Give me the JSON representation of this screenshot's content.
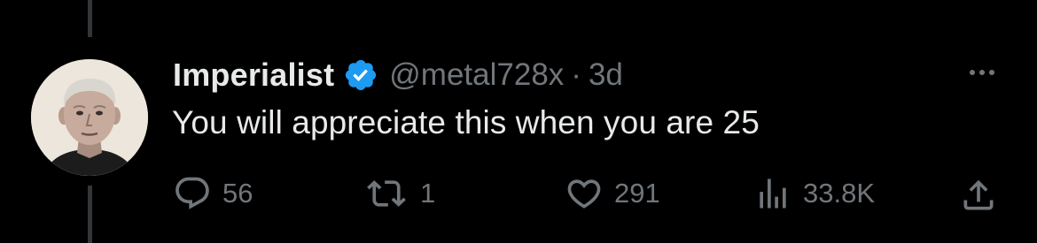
{
  "tweet": {
    "display_name": "Imperialist",
    "handle": "@metal728x",
    "separator": "·",
    "time": "3d",
    "text": "You will appreciate this when you are 25",
    "verified": true
  },
  "actions": {
    "replies": "56",
    "retweets": "1",
    "likes": "291",
    "views": "33.8K"
  },
  "icons": {
    "reply": "reply-icon",
    "retweet": "retweet-icon",
    "like": "heart-icon",
    "views": "analytics-icon",
    "share": "share-icon",
    "more": "more-icon",
    "verified": "verified-badge-icon"
  },
  "colors": {
    "background": "#000000",
    "text_primary": "#e7e9ea",
    "text_secondary": "#71767b",
    "verified_blue": "#1d9bf0",
    "thread_line": "#333639"
  }
}
